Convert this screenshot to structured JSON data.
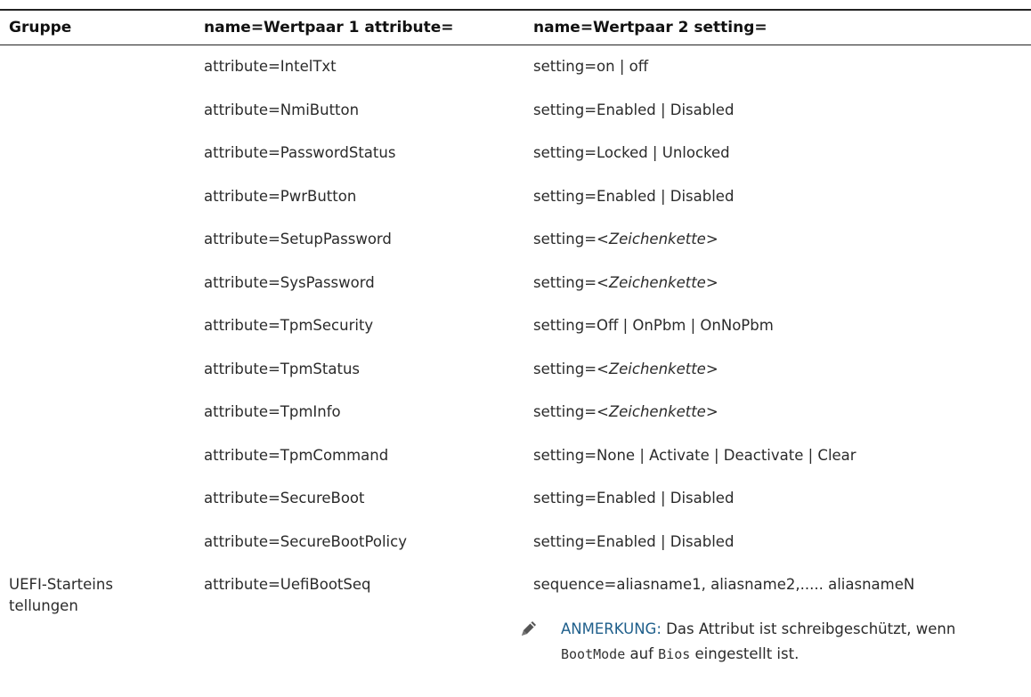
{
  "headers": {
    "group": "Gruppe",
    "pair1": "name=Wertpaar 1 attribute=",
    "pair2": "name=Wertpaar 2 setting="
  },
  "rows": [
    {
      "group": "",
      "attribute": "attribute=IntelTxt",
      "setting": "setting=on | off",
      "italic": false
    },
    {
      "group": "",
      "attribute": "attribute=NmiButton",
      "setting": "setting=Enabled | Disabled",
      "italic": false
    },
    {
      "group": "",
      "attribute": "attribute=PasswordStatus",
      "setting": "setting=Locked | Unlocked",
      "italic": false
    },
    {
      "group": "",
      "attribute": "attribute=PwrButton",
      "setting": "setting=Enabled | Disabled",
      "italic": false
    },
    {
      "group": "",
      "attribute": "attribute=SetupPassword",
      "setting_prefix": "setting=",
      "setting_value": "<Zeichenkette>",
      "italic": true
    },
    {
      "group": "",
      "attribute": "attribute=SysPassword",
      "setting_prefix": "setting=",
      "setting_value": "<Zeichenkette>",
      "italic": true
    },
    {
      "group": "",
      "attribute": "attribute=TpmSecurity",
      "setting": "setting=Off | OnPbm | OnNoPbm",
      "italic": false
    },
    {
      "group": "",
      "attribute": "attribute=TpmStatus",
      "setting_prefix": "setting=",
      "setting_value": "<Zeichenkette>",
      "italic": true
    },
    {
      "group": "",
      "attribute": "attribute=TpmInfo",
      "setting_prefix": "setting=",
      "setting_value": "<Zeichenkette>",
      "italic": true
    },
    {
      "group": "",
      "attribute": "attribute=TpmCommand",
      "setting": "setting=None | Activate | Deactivate | Clear",
      "italic": false
    },
    {
      "group": "",
      "attribute": "attribute=SecureBoot",
      "setting": "setting=Enabled | Disabled",
      "italic": false
    },
    {
      "group": "",
      "attribute": "attribute=SecureBootPolicy",
      "setting": "setting=Enabled | Disabled",
      "italic": false
    }
  ],
  "uefi": {
    "group": "UEFI-Starteinstellungen",
    "attribute": "attribute=UefiBootSeq",
    "setting": "sequence=aliasname1, aliasname2,..... aliasnameN",
    "note": {
      "icon": "pencil-note-icon",
      "label": "ANMERKUNG:",
      "text_before": "Das Attribut ist schreibgeschützt, wenn",
      "code1": "BootMode",
      "text_middle": "auf",
      "code2": "Bios",
      "text_after": "eingestellt ist."
    }
  },
  "colors": {
    "note_label": "#1f5f8b",
    "text": "#2a2a2a"
  }
}
